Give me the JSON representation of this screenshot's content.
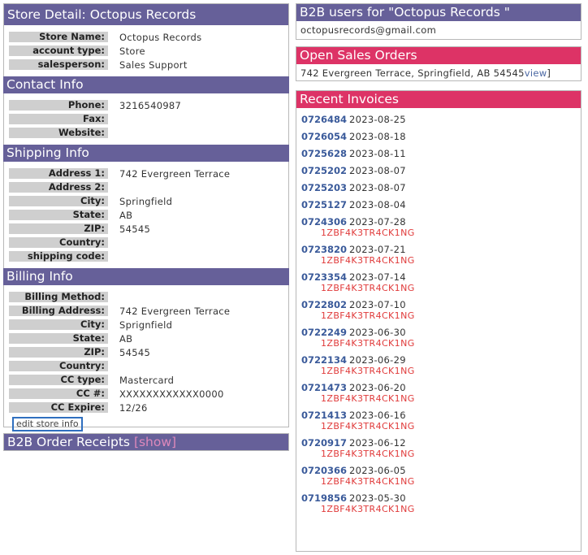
{
  "store": {
    "title": "Store Detail: Octopus Records",
    "fields": [
      {
        "label": "Store Name:",
        "value": "Octopus Records"
      },
      {
        "label": "account type:",
        "value": "Store"
      },
      {
        "label": "salesperson:",
        "value": "Sales Support"
      }
    ]
  },
  "contact": {
    "title": "Contact Info",
    "fields": [
      {
        "label": "Phone:",
        "value": "3216540987"
      },
      {
        "label": "Fax:",
        "value": ""
      },
      {
        "label": "Website:",
        "value": ""
      }
    ]
  },
  "shipping": {
    "title": "Shipping Info",
    "fields": [
      {
        "label": "Address 1:",
        "value": "742 Evergreen Terrace"
      },
      {
        "label": "Address 2:",
        "value": ""
      },
      {
        "label": "City:",
        "value": "Springfield"
      },
      {
        "label": "State:",
        "value": "AB"
      },
      {
        "label": "ZIP:",
        "value": "54545"
      },
      {
        "label": "Country:",
        "value": ""
      },
      {
        "label": "shipping code:",
        "value": ""
      }
    ]
  },
  "billing": {
    "title": "Billing Info",
    "fields": [
      {
        "label": "Billing Method:",
        "value": ""
      },
      {
        "label": "Billing Address:",
        "value": "742 Evergreen Terrace"
      },
      {
        "label": "City:",
        "value": "Sprignfield"
      },
      {
        "label": "State:",
        "value": "AB"
      },
      {
        "label": "ZIP:",
        "value": "54545"
      },
      {
        "label": "Country:",
        "value": ""
      },
      {
        "label": "CC type:",
        "value": "Mastercard"
      },
      {
        "label": "CC #:",
        "value": "XXXXXXXXXXXX0000"
      },
      {
        "label": "CC Expire:",
        "value": "12/26"
      }
    ],
    "edit_button": "edit store info"
  },
  "b2b_receipts": {
    "title": "B2B Order Receipts",
    "show_link": "[show]"
  },
  "b2b_users": {
    "title": "B2B users for \"Octopus Records \"",
    "email": "octopusrecords@gmail.com"
  },
  "open_orders": {
    "title": "Open Sales Orders",
    "address": "742 Evergreen Terrace, Springfield, AB 54545",
    "view_link": "view",
    "close_bracket": "]"
  },
  "invoices": {
    "title": "Recent Invoices",
    "items": [
      {
        "num": "0726484",
        "date": "2023-08-25",
        "track": ""
      },
      {
        "num": "0726054",
        "date": "2023-08-18",
        "track": ""
      },
      {
        "num": "0725628",
        "date": "2023-08-11",
        "track": ""
      },
      {
        "num": "0725202",
        "date": "2023-08-07",
        "track": ""
      },
      {
        "num": "0725203",
        "date": "2023-08-07",
        "track": ""
      },
      {
        "num": "0725127",
        "date": "2023-08-04",
        "track": ""
      },
      {
        "num": "0724306",
        "date": "2023-07-28",
        "track": "1ZBF4K3TR4CK1NG"
      },
      {
        "num": "0723820",
        "date": "2023-07-21",
        "track": "1ZBF4K3TR4CK1NG"
      },
      {
        "num": "0723354",
        "date": "2023-07-14",
        "track": "1ZBF4K3TR4CK1NG"
      },
      {
        "num": "0722802",
        "date": "2023-07-10",
        "track": "1ZBF4K3TR4CK1NG"
      },
      {
        "num": "0722249",
        "date": "2023-06-30",
        "track": "1ZBF4K3TR4CK1NG"
      },
      {
        "num": "0722134",
        "date": "2023-06-29",
        "track": "1ZBF4K3TR4CK1NG"
      },
      {
        "num": "0721473",
        "date": "2023-06-20",
        "track": "1ZBF4K3TR4CK1NG"
      },
      {
        "num": "0721413",
        "date": "2023-06-16",
        "track": "1ZBF4K3TR4CK1NG"
      },
      {
        "num": "0720917",
        "date": "2023-06-12",
        "track": "1ZBF4K3TR4CK1NG"
      },
      {
        "num": "0720366",
        "date": "2023-06-05",
        "track": "1ZBF4K3TR4CK1NG"
      },
      {
        "num": "0719856",
        "date": "2023-05-30",
        "track": "1ZBF4K3TR4CK1NG"
      }
    ]
  },
  "colors": {
    "header_purple": "#666099",
    "header_pink": "#dd3366",
    "label_bg": "#cfcfcf",
    "link_blue": "#3a5a9a",
    "tracking_red": "#e03a3a"
  }
}
